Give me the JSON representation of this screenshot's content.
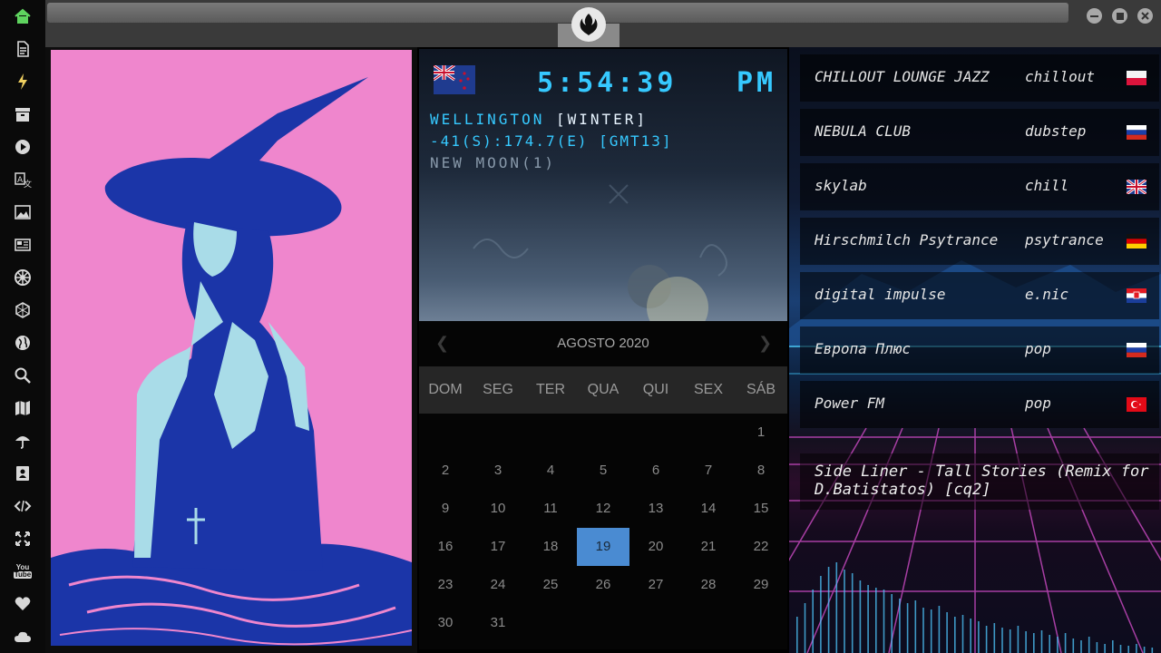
{
  "sidebar": {
    "items": [
      {
        "icon": "home-icon",
        "color": "#5fd35f"
      },
      {
        "icon": "document-icon"
      },
      {
        "icon": "lightning-icon",
        "color": "#f0d060"
      },
      {
        "icon": "archive-icon"
      },
      {
        "icon": "play-circle-icon"
      },
      {
        "icon": "translate-icon"
      },
      {
        "icon": "image-icon"
      },
      {
        "icon": "newspaper-icon"
      },
      {
        "icon": "empire-icon"
      },
      {
        "icon": "hexagon-icon"
      },
      {
        "icon": "globe-icon"
      },
      {
        "icon": "search-icon"
      },
      {
        "icon": "map-icon"
      },
      {
        "icon": "umbrella-icon"
      },
      {
        "icon": "contact-book-icon"
      },
      {
        "icon": "code-icon"
      },
      {
        "icon": "expand-icon"
      },
      {
        "icon": "youtube-icon",
        "label": "You Tube"
      },
      {
        "icon": "heart-icon"
      },
      {
        "icon": "cloud-icon"
      }
    ]
  },
  "topbar": {
    "logo_icon": "rebel-alliance-icon",
    "window_buttons": [
      "minimize-icon",
      "maximize-icon",
      "close-icon"
    ]
  },
  "clock": {
    "time": "5:54:39",
    "ampm": "PM",
    "city": "WELLINGTON",
    "season": "[WINTER]",
    "coords": "-41(S):174.7(E) [GMT13]",
    "moon": "NEW MOON(1)",
    "flag": "new-zealand-flag-icon",
    "digit_color": "#36c9ff"
  },
  "calendar": {
    "title": "AGOSTO 2020",
    "prev_icon": "chevron-left-icon",
    "next_icon": "chevron-right-icon",
    "weekdays": [
      "DOM",
      "SEG",
      "TER",
      "QUA",
      "QUI",
      "SEX",
      "SÁB"
    ],
    "first_weekday_index": 6,
    "days": [
      "1",
      "2",
      "3",
      "4",
      "5",
      "6",
      "7",
      "8",
      "9",
      "10",
      "11",
      "12",
      "13",
      "14",
      "15",
      "16",
      "17",
      "18",
      "19",
      "20",
      "21",
      "22",
      "23",
      "24",
      "25",
      "26",
      "27",
      "28",
      "29",
      "30",
      "31"
    ],
    "today": "19",
    "today_color": "#4a8bd2"
  },
  "radio": {
    "stations": [
      {
        "name": "CHILLOUT LOUNGE JAZZ",
        "genre": "chillout",
        "flag": "poland-flag-icon"
      },
      {
        "name": "NEBULA CLUB",
        "genre": "dubstep",
        "flag": "russia-flag-icon"
      },
      {
        "name": "skylab",
        "genre": "chill",
        "flag": "uk-flag-icon"
      },
      {
        "name": "Hirschmilch Psytrance",
        "genre": "psytrance",
        "flag": "germany-flag-icon"
      },
      {
        "name": "digital impulse",
        "genre": "e.nic",
        "flag": "croatia-flag-icon"
      },
      {
        "name": "Европа Плюс",
        "genre": "pop",
        "flag": "russia-flag-icon"
      },
      {
        "name": "Power FM",
        "genre": "pop",
        "flag": "turkey-flag-icon"
      }
    ],
    "now_playing": "Side Liner - Tall Stories (Remix for D.Batistatos) [cq2]"
  },
  "art": {
    "background": "#ef86cd",
    "ink": "#1b35a8",
    "skin": "#a9dce8"
  }
}
